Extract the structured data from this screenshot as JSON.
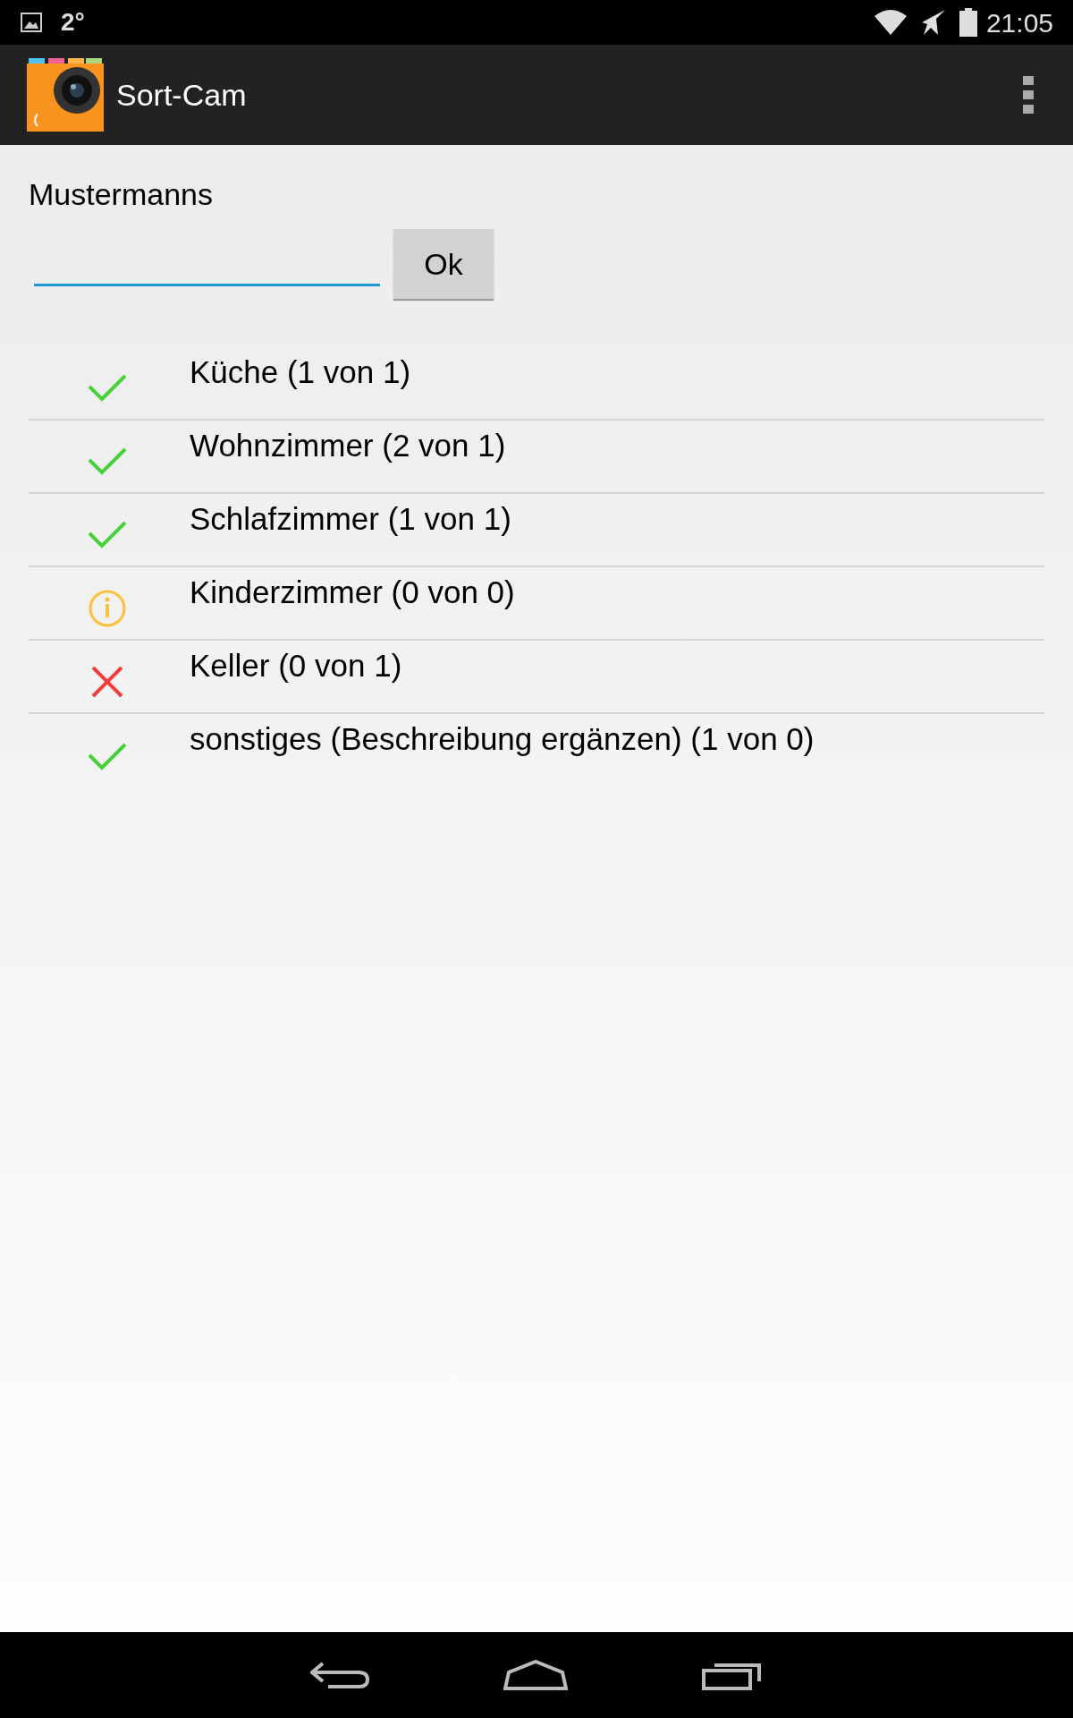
{
  "status_bar": {
    "temperature": "2°",
    "time": "21:05"
  },
  "action_bar": {
    "title": "Sort-Cam"
  },
  "form": {
    "label": "Mustermanns",
    "button": "Ok"
  },
  "rooms": [
    {
      "label": "Küche (1 von 1)",
      "kind": "done"
    },
    {
      "label": "Wohnzimmer (2 von 1)",
      "kind": "done"
    },
    {
      "label": "Schlafzimmer (1 von 1)",
      "kind": "done"
    },
    {
      "label": "Kinderzimmer (0 von 0)",
      "kind": "info"
    },
    {
      "label": "Keller (0 von 1)",
      "kind": "missing"
    },
    {
      "label": "sonstiges (Beschreibung ergänzen) (1 von 0)",
      "kind": "done"
    }
  ]
}
